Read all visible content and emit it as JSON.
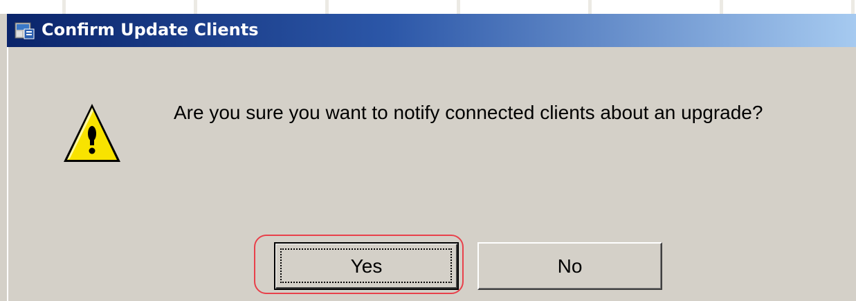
{
  "window": {
    "title": "Confirm Update Clients",
    "title_icon": "app-window-icon",
    "titlebar_color_start": "#0a246a",
    "titlebar_color_end": "#a6caf0",
    "background_color": "#d4d0c8"
  },
  "dialog": {
    "icon": "warning-icon",
    "message": "Are you sure you want to notify connected clients about an upgrade?"
  },
  "buttons": {
    "yes_label": "Yes",
    "no_label": "No",
    "focused": "Yes",
    "highlight_color": "#e8404a"
  }
}
